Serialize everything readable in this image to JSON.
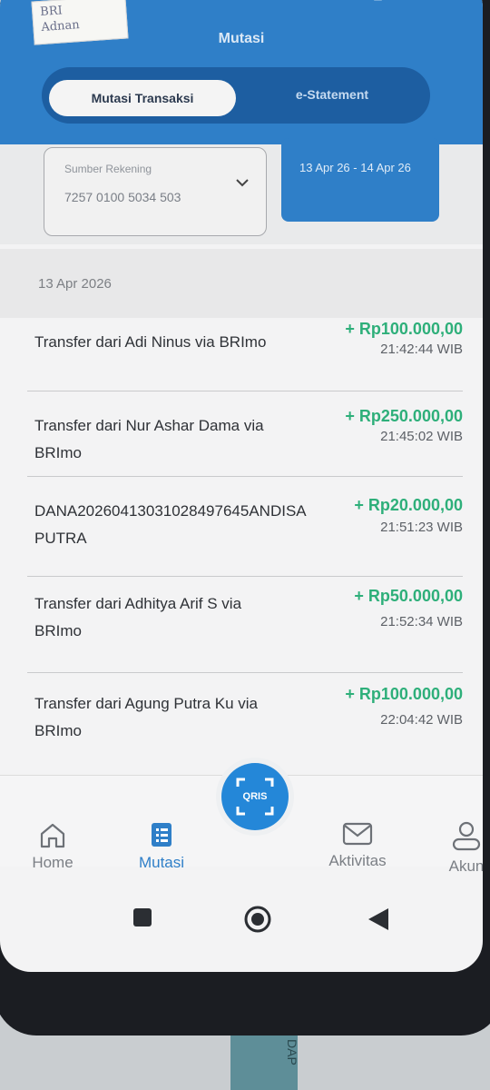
{
  "sticker": {
    "line1": "BRI",
    "line2": "Adnan"
  },
  "header": {
    "title": "Mutasi"
  },
  "tabs": [
    {
      "label": "Mutasi Transaksi",
      "active": true
    },
    {
      "label": "e-Statement",
      "active": false
    }
  ],
  "filter": {
    "account_label": "Sumber Rekening",
    "account_number": "7257 0100 5034 503",
    "date_range": "13 Apr 26 - 14 Apr 26"
  },
  "date_header": "13 Apr 2026",
  "transactions": [
    {
      "description": "Transfer dari Adi Ninus via BRImo",
      "amount": "+ Rp100.000,00",
      "time": "21:42:44 WIB"
    },
    {
      "description": "Transfer dari Nur Ashar Dama via BRImo",
      "amount": "+ Rp250.000,00",
      "time": "21:45:02 WIB"
    },
    {
      "description": "DANA20260413031028497645ANDISAPUTRA",
      "amount": "+ Rp20.000,00",
      "time": "21:51:23 WIB"
    },
    {
      "description": "Transfer dari Adhitya Arif S via BRImo",
      "amount": "+ Rp50.000,00",
      "time": "21:52:34 WIB"
    },
    {
      "description": "Transfer dari Agung Putra Ku via BRImo",
      "amount": "+ Rp100.000,00",
      "time": "22:04:42 WIB"
    }
  ],
  "qris_label": "QRIS",
  "bottom_nav": [
    {
      "label": "Home",
      "icon": "home-icon",
      "active": false
    },
    {
      "label": "Mutasi",
      "icon": "receipt-icon",
      "active": true
    },
    {
      "label": "Aktivitas",
      "icon": "mail-icon",
      "active": false
    },
    {
      "label": "Akun",
      "icon": "user-icon",
      "active": false
    }
  ],
  "cable_text": "DAP",
  "colors": {
    "brand": "#2f7fc8",
    "credit": "#2eaf7a",
    "nav_active": "#2f7fc8",
    "nav_inactive": "#7b7f85"
  }
}
